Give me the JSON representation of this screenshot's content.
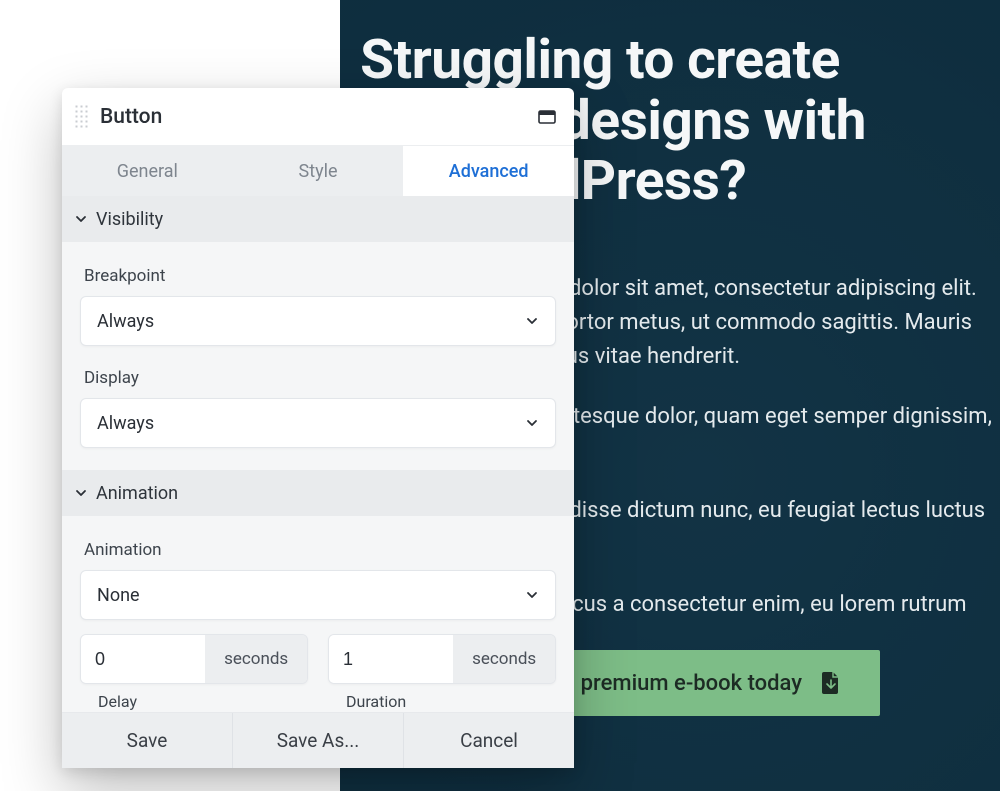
{
  "page": {
    "hero_title": "Struggling to create effective designs with WordPress?",
    "para1": "Lorem ipsum dolor sit amet, consectetur adipiscing elit. Curabitur ac tortor metus, ut commodo sagittis. Mauris non dui a lectus vitae hendrerit.",
    "para2": "Aenean pellentesque dolor, quam eget semper dignissim, dui leo mi.",
    "para3": "Tellus suspendisse dictum nunc, eu feugiat lectus luctus nulla. Ipsum",
    "para4": "Lorem ut rhoncus a consectetur enim, eu lorem  rutrum",
    "cta_label": "Download premium e-book today"
  },
  "panel": {
    "title": "Button",
    "tabs": {
      "general": "General",
      "style": "Style",
      "advanced": "Advanced"
    },
    "visibility": {
      "header": "Visibility",
      "breakpoint_label": "Breakpoint",
      "breakpoint_value": "Always",
      "display_label": "Display",
      "display_value": "Always"
    },
    "animation": {
      "header": "Animation",
      "animation_label": "Animation",
      "animation_value": "None",
      "delay_value": "0",
      "delay_unit": "seconds",
      "delay_label": "Delay",
      "duration_value": "1",
      "duration_unit": "seconds",
      "duration_label": "Duration"
    },
    "footer": {
      "save": "Save",
      "save_as": "Save As...",
      "cancel": "Cancel"
    }
  }
}
